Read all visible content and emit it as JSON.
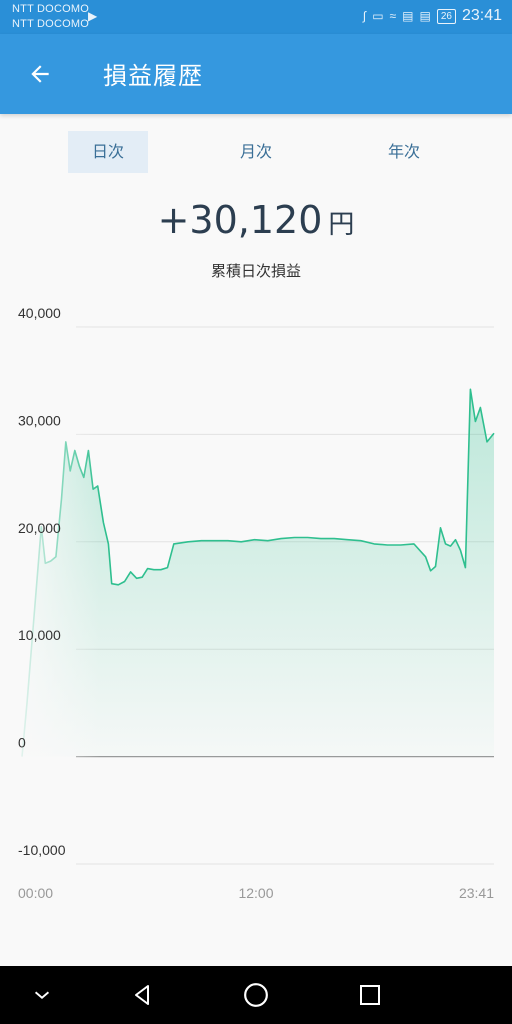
{
  "status_bar": {
    "carrier_1": "NTT DOCOMO",
    "carrier_2": "NTT DOCOMO",
    "battery": "26",
    "time": "23:41"
  },
  "app_bar": {
    "title": "損益履歴",
    "back_icon": "arrow-left-icon"
  },
  "tabs": [
    {
      "label": "日次",
      "active": true
    },
    {
      "label": "月次",
      "active": false
    },
    {
      "label": "年次",
      "active": false
    }
  ],
  "summary": {
    "amount": "+30,120",
    "unit": "円",
    "label": "累積日次損益"
  },
  "colors": {
    "accent": "#3598df",
    "status_bar": "#2a8fd7",
    "line": "#2fbf8f",
    "tab_active_bg": "#e3edf6"
  },
  "chart_data": {
    "type": "area",
    "ylim": [
      -10000,
      40000
    ],
    "y_ticks": [
      "40,000",
      "30,000",
      "20,000",
      "10,000",
      "0",
      "-10,000"
    ],
    "y_tick_values": [
      40000,
      30000,
      20000,
      10000,
      0,
      -10000
    ],
    "x_ticks": [
      "00:00",
      "12:00",
      "23:41"
    ],
    "x_range_minutes": [
      0,
      1421
    ],
    "grid": true,
    "series": [
      {
        "x": [
          0,
          15,
          58,
          70,
          86,
          102,
          119,
          132,
          145,
          159,
          173,
          186,
          200,
          214,
          228,
          245,
          260,
          270,
          290,
          309,
          327,
          345,
          362,
          378,
          397,
          418,
          438,
          457,
          500,
          540,
          580,
          620,
          660,
          700,
          740,
          780,
          820,
          860,
          900,
          940,
          980,
          1020,
          1060,
          1100,
          1140,
          1180,
          1215,
          1230,
          1245,
          1260,
          1275,
          1290,
          1305,
          1320,
          1335,
          1350,
          1365,
          1380,
          1400,
          1421
        ],
        "y": [
          0,
          5000,
          21400,
          18000,
          18200,
          18600,
          24000,
          29300,
          26600,
          28500,
          27000,
          26000,
          28500,
          24900,
          25200,
          21800,
          19800,
          16100,
          16000,
          16300,
          17200,
          16600,
          16700,
          17500,
          17400,
          17400,
          17600,
          19800,
          20000,
          20100,
          20100,
          20100,
          20000,
          20200,
          20100,
          20300,
          20400,
          20400,
          20300,
          20300,
          20200,
          20100,
          19800,
          19700,
          19700,
          19800,
          18600,
          17300,
          17700,
          21300,
          19800,
          19600,
          20200,
          19200,
          17600,
          34200,
          31200,
          32500,
          29300,
          30100
        ]
      }
    ]
  },
  "nav_bar": {
    "icons": [
      "chevron-down-icon",
      "back-triangle-icon",
      "home-circle-icon",
      "recents-square-icon"
    ]
  }
}
